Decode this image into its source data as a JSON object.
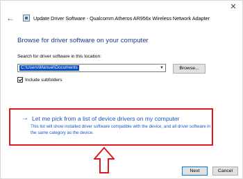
{
  "window": {
    "title": "Update Driver Software - Qualcomm Atheros AR956x Wireless Network Adapter",
    "close_glyph": "✕",
    "back_glyph": "←"
  },
  "main": {
    "heading": "Browse for driver software on your computer",
    "search_label": "Search for driver software in this location:",
    "path_value": "C:\\Users\\Manuel\\Documents",
    "browse_label": "Browse...",
    "include_subfolders_label": "Include subfolders",
    "include_subfolders_checked": true
  },
  "pick_option": {
    "arrow_glyph": "→",
    "title": "Let me pick from a list of device drivers on my computer",
    "description": "This list will show installed driver software compatible with the device, and all driver software in the same category as the device."
  },
  "footer": {
    "next_label": "Next",
    "cancel_label": "Cancel"
  },
  "colors": {
    "link_blue": "#1a56c8",
    "heading_blue": "#1a3b8c",
    "highlight_red": "#e0191f",
    "selection_blue": "#0a4fbf"
  }
}
